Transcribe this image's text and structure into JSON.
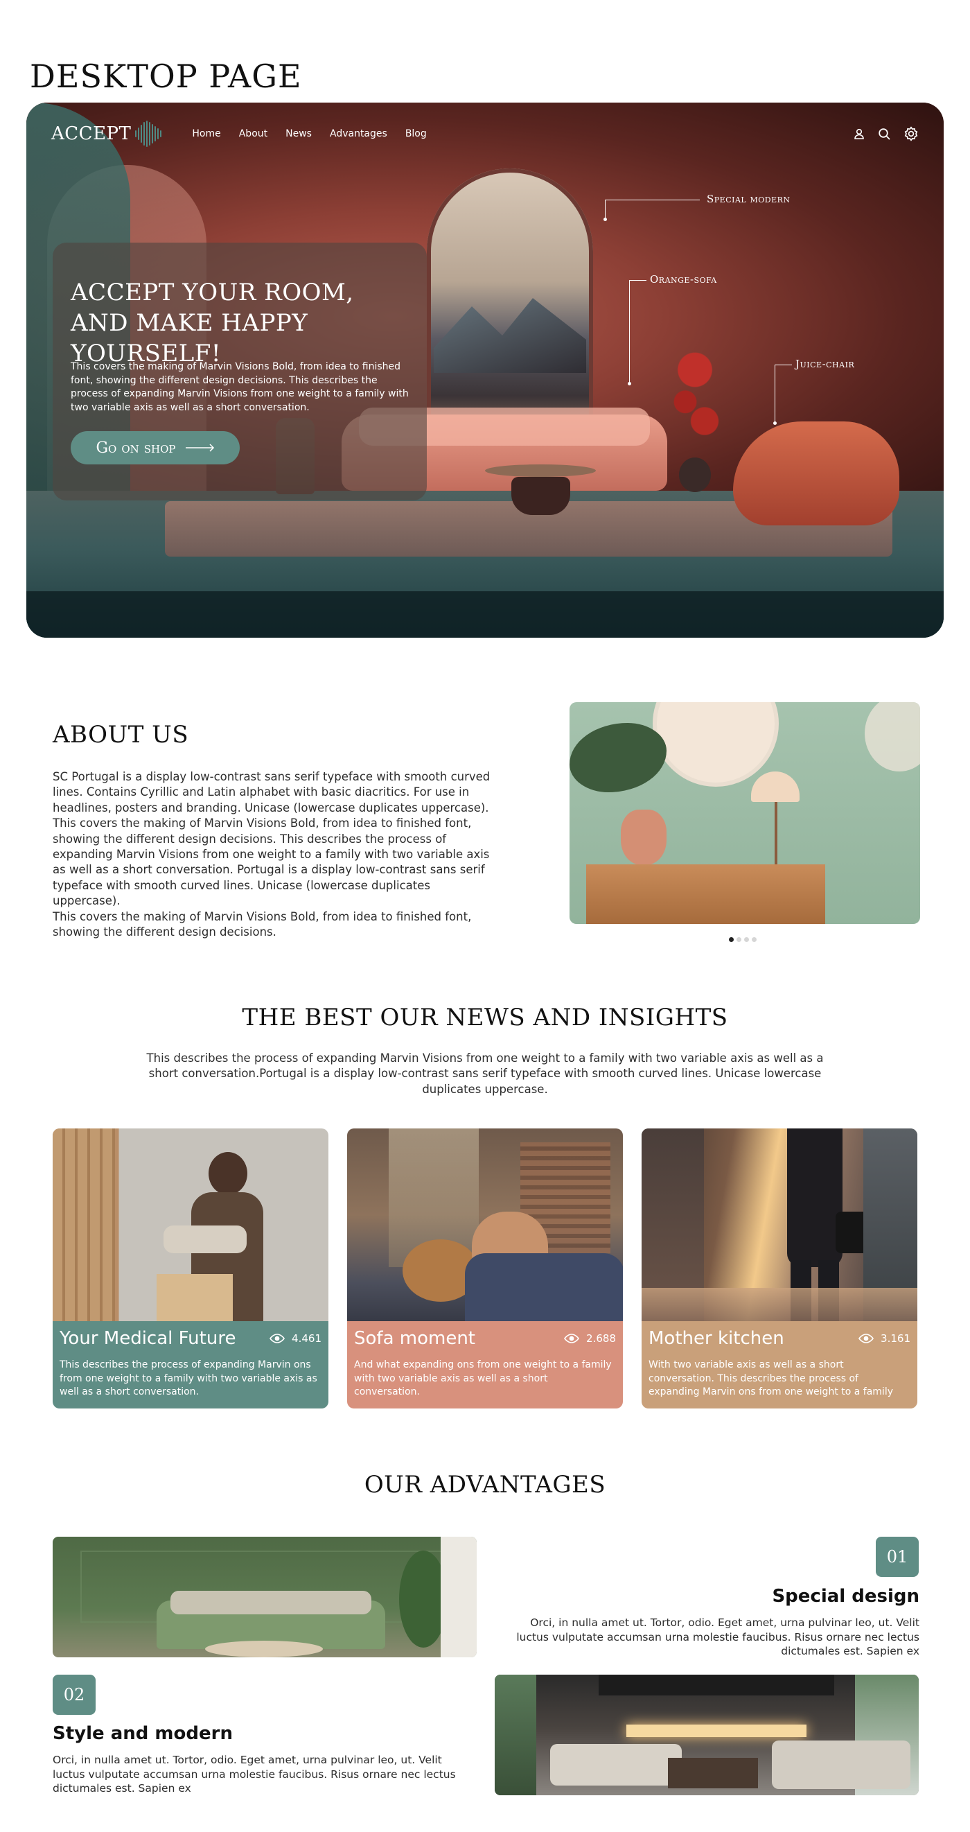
{
  "page_title": "DESKTOP PAGE",
  "hero": {
    "logo": "ACCEPT",
    "nav": [
      "Home",
      "About",
      "News",
      "Advantages",
      "Blog"
    ],
    "icons": [
      "user-icon",
      "search-icon",
      "settings-icon"
    ],
    "heading_line1": "ACCEPT YOUR ROOM,",
    "heading_line2": "AND MAKE HAPPY YOURSELF!",
    "description": "This covers the making of Marvin Visions Bold, from idea to finished font, showing the different design decisions. This describes the process of expanding Marvin Visions from one weight to a family with two variable axis as well as a short conversation.",
    "button_label": "Go on shop",
    "callouts": [
      "Special modern",
      "Orange-sofa",
      "Juice-chair"
    ]
  },
  "about": {
    "title": "ABOUT US",
    "paragraphs": [
      "SC Portugal is a display low-contrast sans serif typeface with smooth curved lines. Contains Cyrillic and Latin alphabet with basic diacritics. For use in headlines, posters and branding. Unicase (lowercase duplicates uppercase).",
      "This covers the making of Marvin Visions Bold, from idea to finished font, showing the different design decisions. This describes the process of expanding Marvin Visions from one weight to a family with two variable axis as well as a short conversation. Portugal is a display low-contrast sans serif typeface with smooth curved lines. Unicase (lowercase duplicates uppercase).",
      "This covers the making of Marvin Visions Bold, from idea to finished font, showing the different design decisions."
    ],
    "carousel_active": 1,
    "carousel_count": 4
  },
  "news": {
    "title": "THE BEST OUR NEWS AND INSIGHTS",
    "description": "This describes the process of expanding Marvin Visions from one weight to a family with two variable axis as well as a short conversation.Portugal is a display low-contrast sans serif typeface with smooth curved lines. Unicase lowercase duplicates uppercase.",
    "cards": [
      {
        "title": "Your Medical Future",
        "views": "4.461",
        "text": "This describes the process of expanding Marvin ons from one weight to a family with two variable axis as well as a short conversation.",
        "color": "#5f8d85"
      },
      {
        "title": "Sofa moment",
        "views": "2.688",
        "text": "And what expanding ons from one weight to a family with two variable axis as well as a short conversation.",
        "color": "#d8917d"
      },
      {
        "title": "Mother kitchen",
        "views": "3.161",
        "text": "With two variable axis as well as a short conversation. This describes the process of expanding Marvin ons from one weight to a family",
        "color": "#c9a07a"
      }
    ]
  },
  "advantages": {
    "title": "OUR ADVANTAGES",
    "items": [
      {
        "number": "01",
        "heading": "Special design",
        "text": "Orci, in nulla amet ut. Tortor, odio. Eget amet, urna pulvinar leo, ut. Velit luctus vulputate accumsan urna molestie faucibus. Risus ornare nec lectus dictumales est. Sapien ex"
      },
      {
        "number": "02",
        "heading": "Style and modern",
        "text": "Orci, in nulla amet ut. Tortor, odio. Eget amet, urna pulvinar leo, ut. Velit luctus vulputate accumsan urna molestie faucibus. Risus ornare nec lectus dictumales est. Sapien ex"
      }
    ]
  },
  "colors": {
    "accent": "#5f8d85",
    "sofa": "#d8917d",
    "kitchen": "#c9a07a"
  }
}
